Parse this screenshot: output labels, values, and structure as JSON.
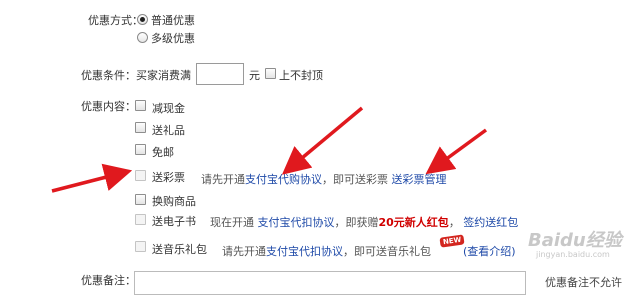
{
  "discount_type": {
    "label": "优惠方式：",
    "options": [
      {
        "label": "普通优惠",
        "selected": true
      },
      {
        "label": "多级优惠",
        "selected": false
      }
    ]
  },
  "discount_condition": {
    "label": "优惠条件：",
    "prefix": "买家消费满",
    "amount_value": "",
    "unit": "元",
    "no_cap_label": "上不封顶"
  },
  "discount_content": {
    "label": "优惠内容：",
    "items": [
      {
        "label": "减现金"
      },
      {
        "label": "送礼品"
      },
      {
        "label": "免邮"
      },
      {
        "label": "送彩票",
        "hint_prefix": "请先开通",
        "hint_link": "支付宝代购协议",
        "hint_middle": "，即可送彩票",
        "hint_link2": "送彩票管理"
      },
      {
        "label": "换购商品"
      },
      {
        "label": "送电子书",
        "hint_prefix": "现在开通",
        "hint_link": "支付宝代扣协议",
        "hint_middle": "，即获赠",
        "hint_red": "20元新人红包",
        "hint_sep": "，",
        "hint_link2": "签约送红包"
      },
      {
        "label": "送音乐礼包",
        "hint_prefix": "请先开通",
        "hint_link": "支付宝代扣协议",
        "hint_middle": "，即可送音乐礼包",
        "hint_link2": "(查看介绍)",
        "badge": "NEW"
      }
    ]
  },
  "remark": {
    "label": "优惠备注：",
    "side_note": "优惠备注不允许"
  },
  "watermark": {
    "text": "Baidu经验",
    "url": "jingyan.baidu.com"
  },
  "colors": {
    "link": "#1f4aa8",
    "highlight": "#d00000",
    "arrow": "#e0191e"
  }
}
